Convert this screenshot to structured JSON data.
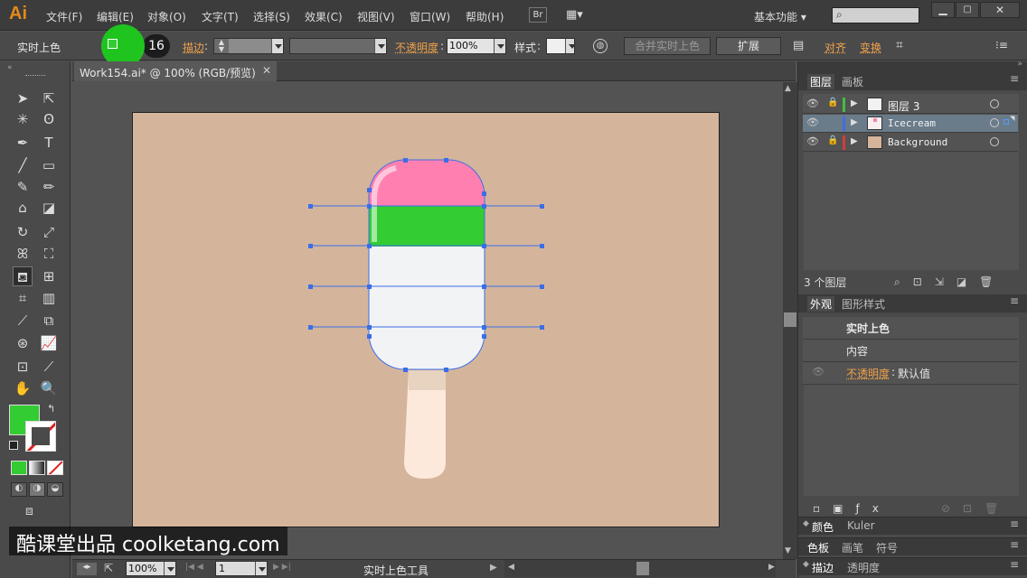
{
  "app": {
    "logo": "Ai",
    "workspace": "基本功能"
  },
  "menu": [
    "文件(F)",
    "编辑(E)",
    "对象(O)",
    "文字(T)",
    "选择(S)",
    "效果(C)",
    "视图(V)",
    "窗口(W)",
    "帮助(H)"
  ],
  "bridge_label": "Br",
  "options": {
    "tool_label": "实时上色",
    "fill_color": "#33cc33",
    "swatch_number": "16",
    "stroke_label": "描边",
    "opacity_label": "不透明度",
    "opacity_value": "100%",
    "style_label": "样式",
    "merge_button": "合并实时上色",
    "expand_button": "扩展",
    "align_label": "对齐",
    "transform_label": "变换"
  },
  "document": {
    "tab_title": "Work154.ai* @ 100% (RGB/预览)"
  },
  "status": {
    "zoom": "100%",
    "page": "1",
    "tool_name": "实时上色工具"
  },
  "layers_panel": {
    "tabs": [
      "图层",
      "画板"
    ],
    "layers": [
      {
        "name": "图层 3",
        "color": "#3fbf3f"
      },
      {
        "name": "Icecream",
        "color": "#3f6fe0"
      },
      {
        "name": "Background",
        "color": "#d23c3c"
      }
    ],
    "count": "3 个图层"
  },
  "appearance_panel": {
    "tabs": [
      "外观",
      "图形样式"
    ],
    "title": "实时上色",
    "content_label": "内容",
    "opacity_label": "不透明度",
    "opacity_value": "默认值"
  },
  "collapsed_panels": [
    [
      "颜色",
      "Kuler"
    ],
    [
      "色板",
      "画笔",
      "符号"
    ],
    [
      "描边",
      "透明度"
    ]
  ],
  "watermark": "酷课堂出品 coolketang.com",
  "colors": {
    "artboard": "#d4b59c",
    "pink": "#ff80b0",
    "green": "#33cc33",
    "white": "#f2f3f5",
    "stick": "#fde9dc"
  }
}
